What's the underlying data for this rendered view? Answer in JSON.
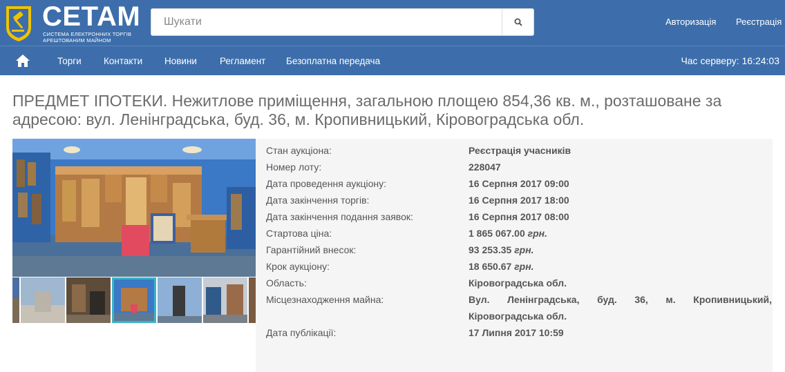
{
  "brand": {
    "name": "СЕТАМ",
    "subtitle_line1": "СИСТЕМА ЕЛЕКТРОННИХ ТОРГІВ",
    "subtitle_line2": "АРЕШТОВАНИМ МАЙНОМ",
    "primary_color": "#3d6eab",
    "accent_color": "#f2c200"
  },
  "search": {
    "placeholder": "Шукати",
    "icon": "search-icon"
  },
  "auth": {
    "login": "Авторизація",
    "register": "Реєстрація"
  },
  "nav": {
    "home_icon": "home-icon",
    "items": [
      "Торги",
      "Контакти",
      "Новини",
      "Регламент",
      "Безоплатна передача"
    ],
    "server_time": "Час серверу: 16:24:03"
  },
  "lot": {
    "title": "ПРЕДМЕТ ІПОТЕКИ. Нежитлове приміщення, загальною площею 854,36 кв. м., розташоване за адресою: вул. Ленінградська, буд. 36, м. Кропивницький, Кіровоградська обл.",
    "details": [
      {
        "label": "Стан аукціона:",
        "value": "Реєстрація учасників"
      },
      {
        "label": "Номер лоту:",
        "value": "228047"
      },
      {
        "label": "Дата проведення аукціону:",
        "value": "16 Серпня 2017 09:00"
      },
      {
        "label": "Дата закінчення торгів:",
        "value": "16 Серпня 2017 18:00"
      },
      {
        "label": "Дата закінчення подання заявок:",
        "value": "16 Серпня 2017 08:00"
      },
      {
        "label": "Стартова ціна:",
        "value": "1 865 067.00",
        "currency": "грн."
      },
      {
        "label": "Гарантійний внесок:",
        "value": "93 253.35",
        "currency": "грн."
      },
      {
        "label": "Крок аукціону:",
        "value": "18 650.67",
        "currency": "грн."
      },
      {
        "label": "Область:",
        "value": "Кіровоградська обл."
      },
      {
        "label": "Місцезнаходження майна:",
        "value_line1": "Вул. Ленінградська, буд. 36, м. Кропивницький,",
        "value_line2": "Кіровоградська обл."
      },
      {
        "label": "Дата публікації:",
        "value": "17 Липня 2017 10:59"
      }
    ]
  },
  "gallery": {
    "thumb_count": 6,
    "active_thumb": 3,
    "active_border_color": "#39b4c9"
  }
}
